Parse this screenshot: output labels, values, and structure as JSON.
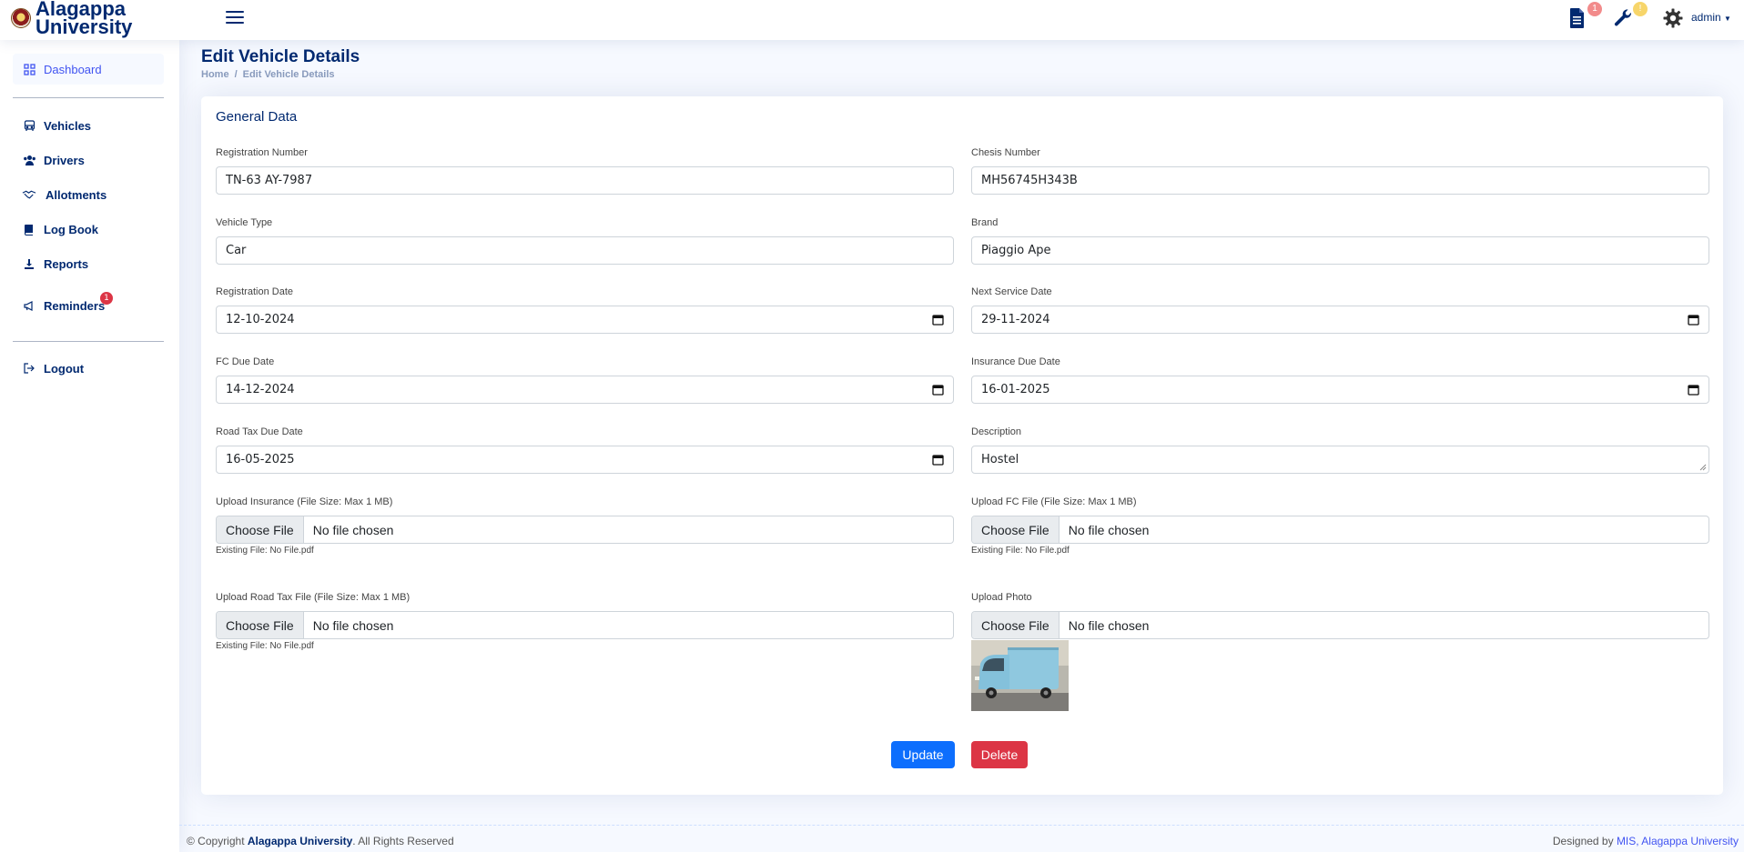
{
  "app": {
    "logo_text_line1": "Alagappa",
    "logo_text_line2": "University",
    "user_name": "admin",
    "notifications": {
      "documents_count": "1",
      "tools_count": "!"
    }
  },
  "sidebar": {
    "dashboard": "Dashboard",
    "items": [
      {
        "label": "Vehicles",
        "icon": "bus-icon"
      },
      {
        "label": "Drivers",
        "icon": "people-icon"
      },
      {
        "label": "Allotments",
        "icon": "handshake-icon"
      },
      {
        "label": "Log Book",
        "icon": "book-icon"
      },
      {
        "label": "Reports",
        "icon": "download-icon"
      },
      {
        "label": "Reminders",
        "icon": "megaphone-icon",
        "badge": "1"
      }
    ],
    "logout": "Logout"
  },
  "page": {
    "title": "Edit Vehicle Details",
    "breadcrumb_home": "Home",
    "breadcrumb_current": "Edit Vehicle Details"
  },
  "form": {
    "section_title": "General Data",
    "registration_number": {
      "label": "Registration Number",
      "value": "TN-63 AY-7987"
    },
    "chesis_number": {
      "label": "Chesis Number",
      "value": "MH56745H343B"
    },
    "vehicle_type": {
      "label": "Vehicle Type",
      "value": "Car"
    },
    "brand": {
      "label": "Brand",
      "value": "Piaggio Ape"
    },
    "registration_date": {
      "label": "Registration Date",
      "value": "12-10-2024"
    },
    "next_service_date": {
      "label": "Next Service Date",
      "value": "29-11-2024"
    },
    "fc_due_date": {
      "label": "FC Due Date",
      "value": "14-12-2024"
    },
    "insurance_due_date": {
      "label": "Insurance Due Date",
      "value": "16-01-2025"
    },
    "road_tax_due_date": {
      "label": "Road Tax Due Date",
      "value": "16-05-2025"
    },
    "description": {
      "label": "Description",
      "value": "Hostel"
    },
    "upload_insurance": {
      "label": "Upload Insurance (File Size: Max 1 MB)",
      "existing": "Existing File: No File.pdf"
    },
    "upload_fc": {
      "label": "Upload FC File (File Size: Max 1 MB)",
      "existing": "Existing File: No File.pdf"
    },
    "upload_road_tax": {
      "label": "Upload Road Tax File (File Size: Max 1 MB)",
      "existing": "Existing File: No File.pdf"
    },
    "upload_photo": {
      "label": "Upload Photo"
    },
    "file_button": "Choose File",
    "file_placeholder": "No file chosen",
    "update_label": "Update",
    "delete_label": "Delete"
  },
  "footer": {
    "copyright_prefix": "© Copyright ",
    "copyright_org": "Alagappa University",
    "copyright_suffix": ". All Rights Reserved",
    "designed_by": "Designed by ",
    "designer": "MIS, Alagappa University"
  },
  "colors": {
    "navy": "#012970",
    "primary": "#0d6efd",
    "danger": "#dc3545",
    "accent": "#4154f1"
  }
}
